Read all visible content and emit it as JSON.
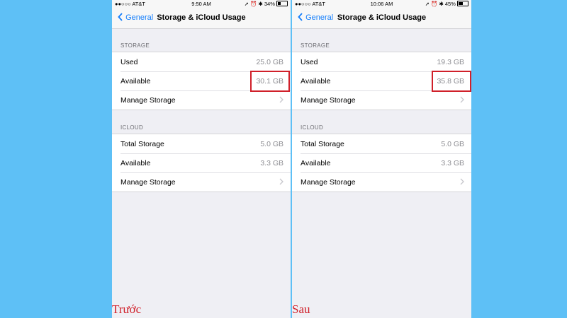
{
  "panels": [
    {
      "status": {
        "carrier": "●●○○○ AT&T",
        "time": "9:50 AM",
        "battery": "34%",
        "battery_level": 0.34
      },
      "nav": {
        "back": "General",
        "title": "Storage & iCloud Usage"
      },
      "storage": {
        "header": "STORAGE",
        "rows": [
          {
            "label": "Used",
            "value": "25.0 GB"
          },
          {
            "label": "Available",
            "value": "30.1 GB"
          },
          {
            "label": "Manage Storage"
          }
        ]
      },
      "icloud": {
        "header": "ICLOUD",
        "rows": [
          {
            "label": "Total Storage",
            "value": "5.0 GB"
          },
          {
            "label": "Available",
            "value": "3.3 GB"
          },
          {
            "label": "Manage Storage"
          }
        ]
      },
      "caption": "Trước"
    },
    {
      "status": {
        "carrier": "●●○○○ AT&T",
        "time": "10:06 AM",
        "battery": "45%",
        "battery_level": 0.45
      },
      "nav": {
        "back": "General",
        "title": "Storage & iCloud Usage"
      },
      "storage": {
        "header": "STORAGE",
        "rows": [
          {
            "label": "Used",
            "value": "19.3 GB"
          },
          {
            "label": "Available",
            "value": "35.8 GB"
          },
          {
            "label": "Manage Storage"
          }
        ]
      },
      "icloud": {
        "header": "ICLOUD",
        "rows": [
          {
            "label": "Total Storage",
            "value": "5.0 GB"
          },
          {
            "label": "Available",
            "value": "3.3 GB"
          },
          {
            "label": "Manage Storage"
          }
        ]
      },
      "caption": "Sau"
    }
  ],
  "colors": {
    "background": "#5ec0f6",
    "accent": "#147efb",
    "highlight": "#d0202a"
  }
}
